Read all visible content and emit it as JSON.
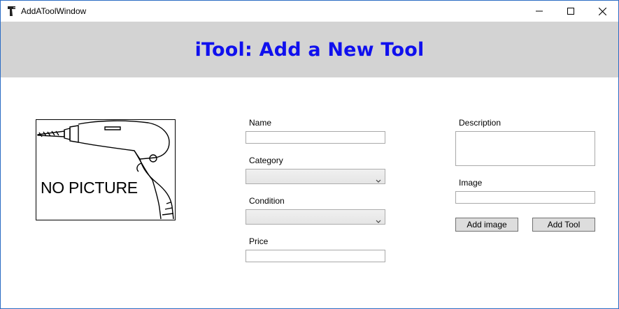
{
  "window": {
    "title": "AddAToolWindow"
  },
  "header": {
    "title": "iTool: Add a New Tool"
  },
  "picture": {
    "placeholder_text": "NO PICTURE"
  },
  "form": {
    "name_label": "Name",
    "name_value": "",
    "category_label": "Category",
    "category_value": "",
    "condition_label": "Condition",
    "condition_value": "",
    "price_label": "Price",
    "price_value": "",
    "description_label": "Description",
    "description_value": "",
    "image_label": "Image",
    "image_value": ""
  },
  "buttons": {
    "add_image": "Add image",
    "add_tool": "Add Tool"
  },
  "colors": {
    "header_bg": "#d3d3d3",
    "header_text": "#1010ee",
    "window_border": "#2b6cc4"
  }
}
